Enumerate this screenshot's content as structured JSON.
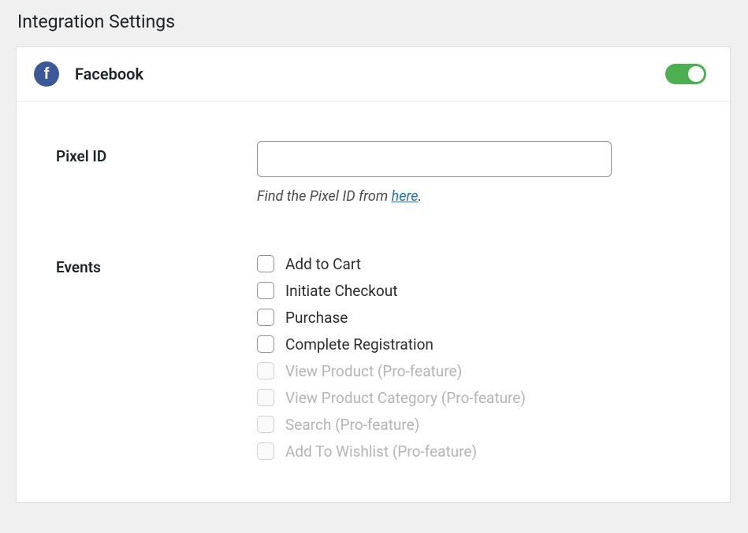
{
  "page_title": "Integration Settings",
  "header": {
    "integration_name": "Facebook",
    "toggle_on": true
  },
  "pixel_id": {
    "label": "Pixel ID",
    "value": "",
    "help_prefix": "Find the Pixel ID from ",
    "help_link_text": "here",
    "help_suffix": "."
  },
  "events": {
    "label": "Events",
    "items": [
      {
        "label": "Add to Cart",
        "disabled": false,
        "checked": false
      },
      {
        "label": "Initiate Checkout",
        "disabled": false,
        "checked": false
      },
      {
        "label": "Purchase",
        "disabled": false,
        "checked": false
      },
      {
        "label": "Complete Registration",
        "disabled": false,
        "checked": false
      },
      {
        "label": "View Product (Pro-feature)",
        "disabled": true,
        "checked": false
      },
      {
        "label": "View Product Category (Pro-feature)",
        "disabled": true,
        "checked": false
      },
      {
        "label": "Search (Pro-feature)",
        "disabled": true,
        "checked": false
      },
      {
        "label": "Add To Wishlist (Pro-feature)",
        "disabled": true,
        "checked": false
      }
    ]
  }
}
